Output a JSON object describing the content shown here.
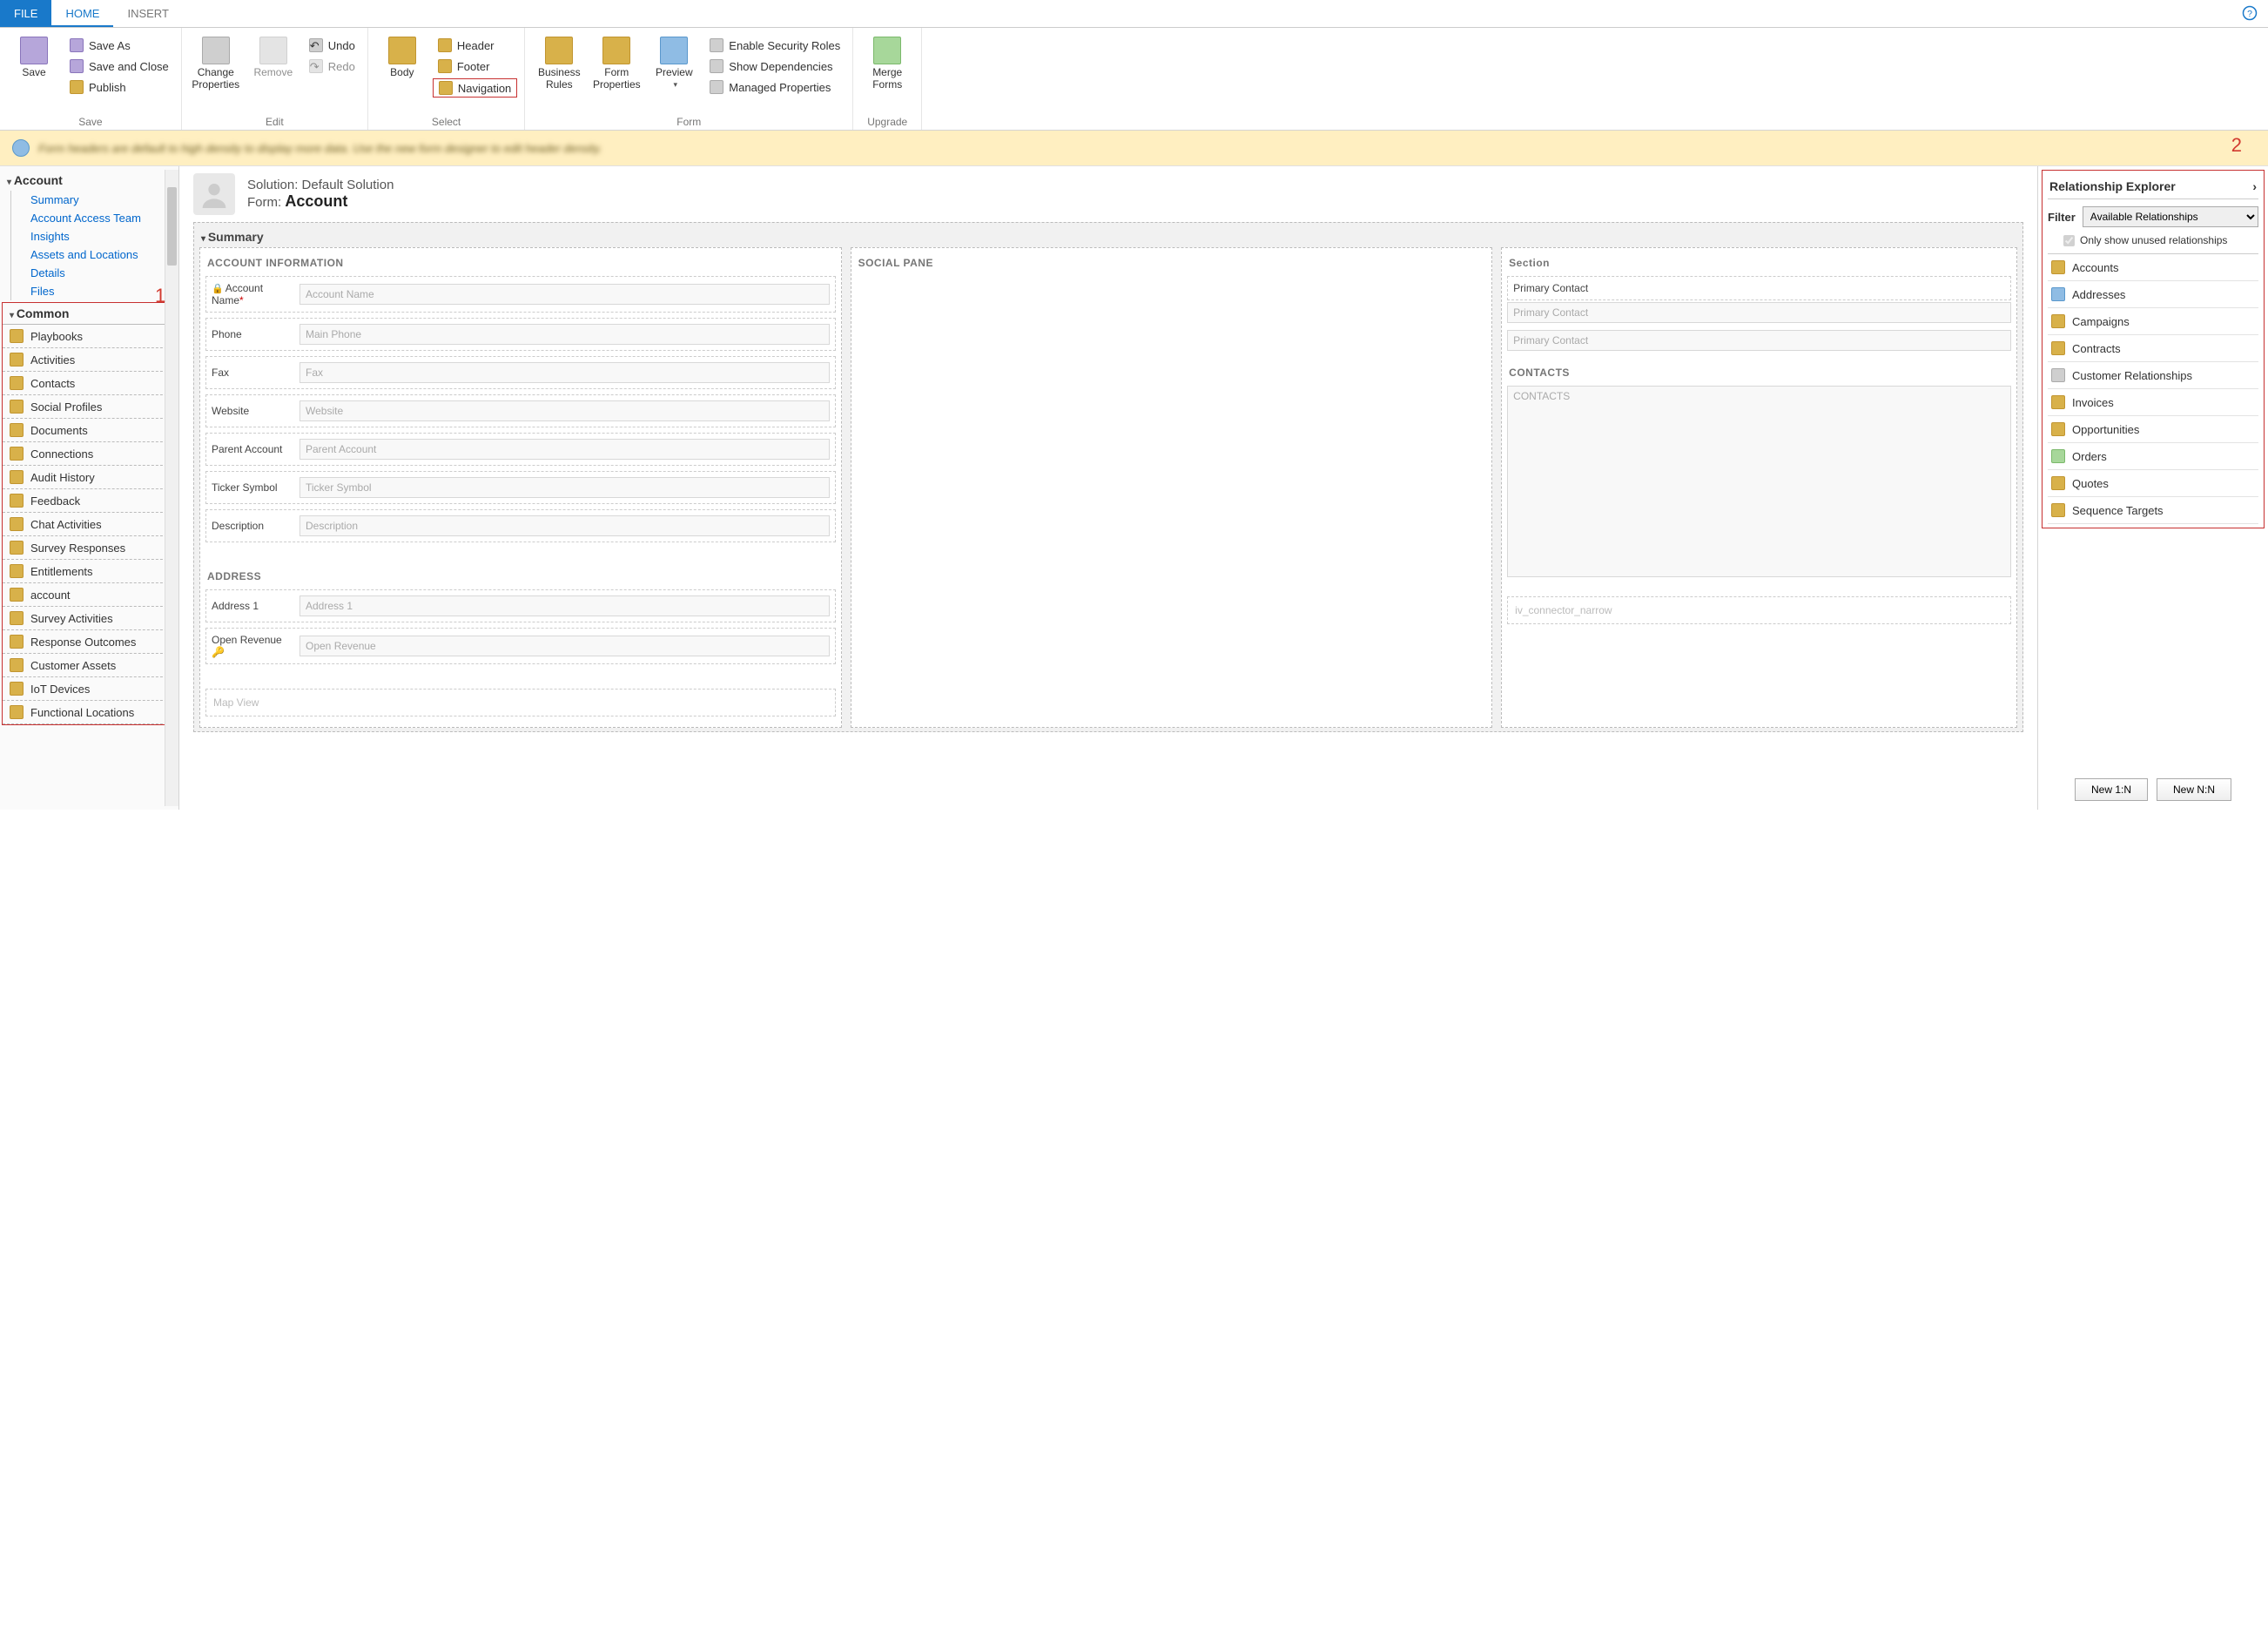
{
  "tabs": {
    "file": "FILE",
    "home": "HOME",
    "insert": "INSERT"
  },
  "ribbon": {
    "save_group": "Save",
    "save": "Save",
    "save_as": "Save As",
    "save_close": "Save and Close",
    "publish": "Publish",
    "edit_group": "Edit",
    "change_props": "Change Properties",
    "remove": "Remove",
    "undo": "Undo",
    "redo": "Redo",
    "select_group": "Select",
    "body": "Body",
    "header": "Header",
    "footer": "Footer",
    "navigation": "Navigation",
    "form_group": "Form",
    "biz_rules": "Business Rules",
    "form_props": "Form Properties",
    "preview": "Preview",
    "enable_sec": "Enable Security Roles",
    "show_dep": "Show Dependencies",
    "managed": "Managed Properties",
    "upgrade_group": "Upgrade",
    "merge": "Merge Forms"
  },
  "infobar": "Form headers are default to high density to display more data. Use the new form designer to edit header density.",
  "annot": {
    "one": "1",
    "two": "2"
  },
  "tree": {
    "account": "Account",
    "items": [
      "Summary",
      "Account Access Team",
      "Insights",
      "Assets and Locations",
      "Details",
      "Files"
    ],
    "common": "Common",
    "common_items": [
      "Playbooks",
      "Activities",
      "Contacts",
      "Social Profiles",
      "Documents",
      "Connections",
      "Audit History",
      "Feedback",
      "Chat Activities",
      "Survey Responses",
      "Entitlements",
      "account",
      "Survey Activities",
      "Response Outcomes",
      "Customer Assets",
      "IoT Devices",
      "Functional Locations"
    ]
  },
  "form": {
    "solution_label": "Solution: ",
    "solution": "Default Solution",
    "form_label": "Form: ",
    "form_name": "Account",
    "summary": "Summary",
    "acct_info": "ACCOUNT INFORMATION",
    "fields": {
      "accountname_l": "Account Name",
      "accountname_p": "Account Name",
      "phone_l": "Phone",
      "phone_p": "Main Phone",
      "fax_l": "Fax",
      "fax_p": "Fax",
      "website_l": "Website",
      "website_p": "Website",
      "parent_l": "Parent Account",
      "parent_p": "Parent Account",
      "ticker_l": "Ticker Symbol",
      "ticker_p": "Ticker Symbol",
      "desc_l": "Description",
      "desc_p": "Description"
    },
    "address": "ADDRESS",
    "address_fields": {
      "a1_l": "Address 1",
      "a1_p": "Address 1",
      "rev_l": "Open Revenue",
      "rev_p": "Open Revenue"
    },
    "mapview": "Map View",
    "social": "SOCIAL PANE",
    "section": "Section",
    "primary_l": "Primary Contact",
    "primary_p": "Primary Contact",
    "contacts_h": "CONTACTS",
    "contacts_p": "CONTACTS",
    "iv": "iv_connector_narrow"
  },
  "rel": {
    "title": "Relationship Explorer",
    "filter_l": "Filter",
    "filter_v": "Available Relationships",
    "only_unused": "Only show unused relationships",
    "items": [
      "Accounts",
      "Addresses",
      "Campaigns",
      "Contracts",
      "Customer Relationships",
      "Invoices",
      "Opportunities",
      "Orders",
      "Quotes",
      "Sequence Targets"
    ]
  },
  "buttons": {
    "new1n": "New 1:N",
    "newnn": "New N:N"
  }
}
